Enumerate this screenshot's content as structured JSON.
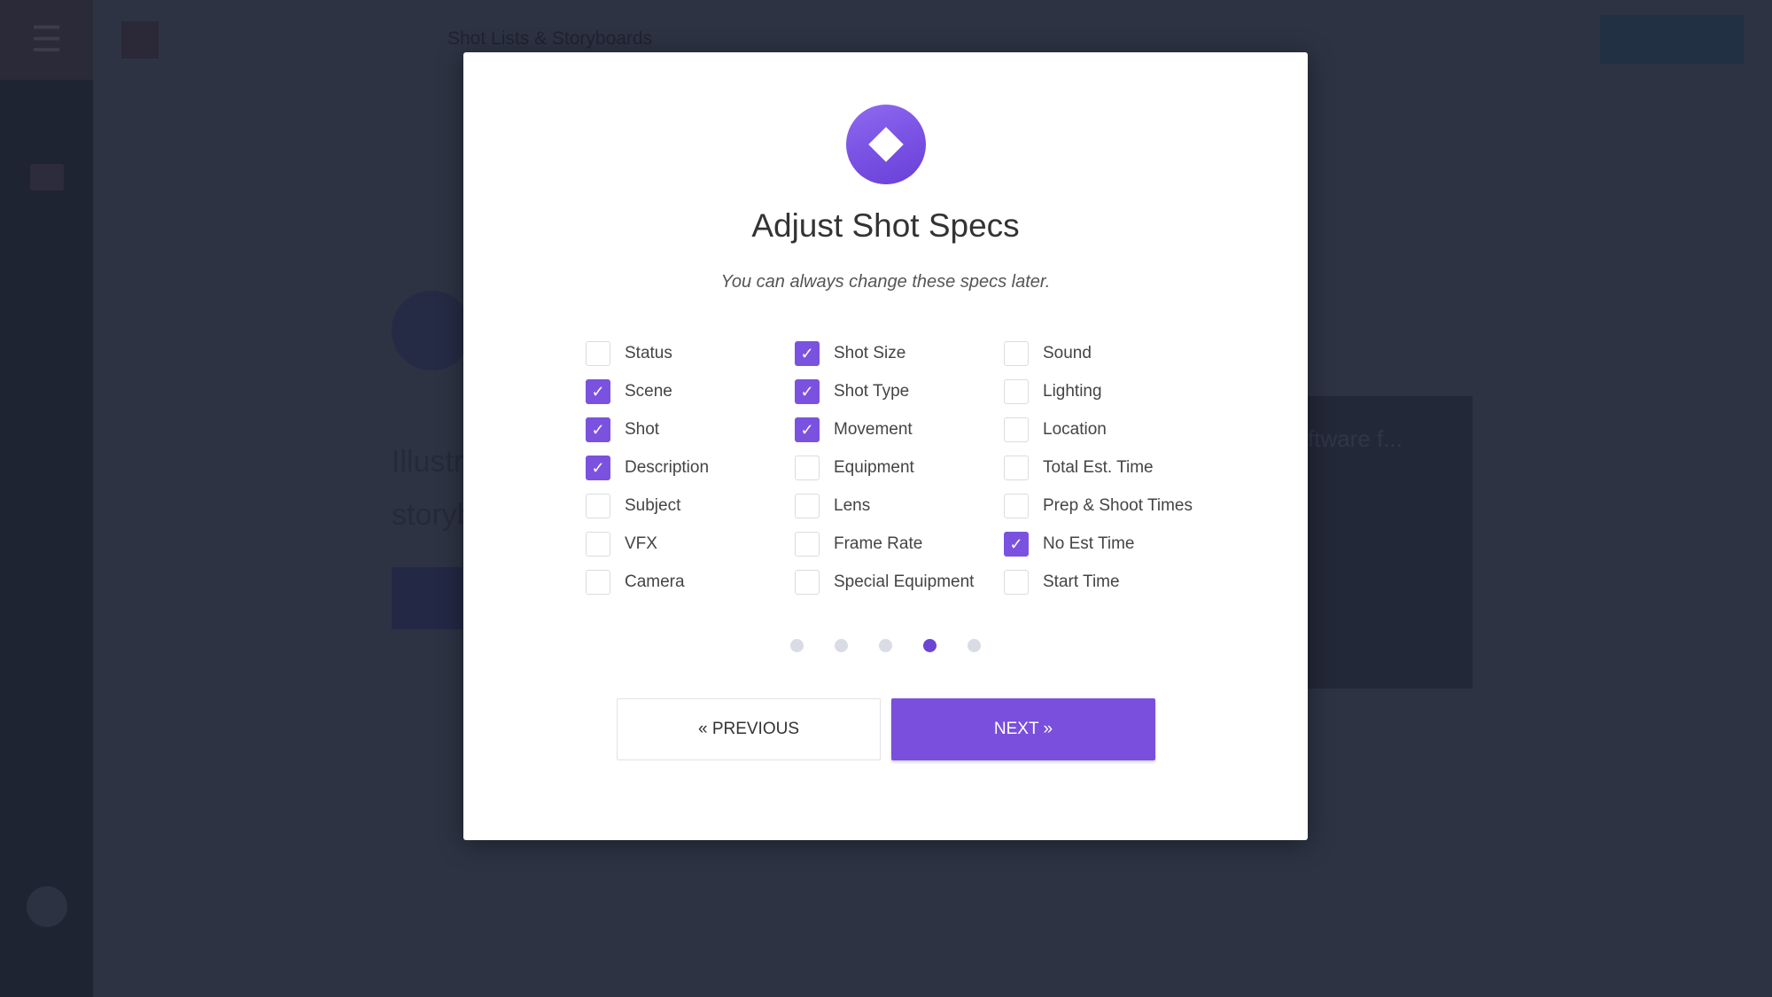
{
  "app": {
    "header_title": "Shot Lists & Storyboards"
  },
  "background": {
    "heading_line1": "Illustr",
    "heading_line2": "storyb",
    "card_title": "ftware f..."
  },
  "modal": {
    "title": "Adjust Shot Specs",
    "subtitle": "You can always change these specs later.",
    "columns": [
      [
        {
          "label": "Status",
          "checked": false
        },
        {
          "label": "Scene",
          "checked": true
        },
        {
          "label": "Shot",
          "checked": true
        },
        {
          "label": "Description",
          "checked": true
        },
        {
          "label": "Subject",
          "checked": false
        },
        {
          "label": "VFX",
          "checked": false
        },
        {
          "label": "Camera",
          "checked": false
        }
      ],
      [
        {
          "label": "Shot Size",
          "checked": true
        },
        {
          "label": "Shot Type",
          "checked": true
        },
        {
          "label": "Movement",
          "checked": true
        },
        {
          "label": "Equipment",
          "checked": false
        },
        {
          "label": "Lens",
          "checked": false
        },
        {
          "label": "Frame Rate",
          "checked": false
        },
        {
          "label": "Special Equipment",
          "checked": false
        }
      ],
      [
        {
          "label": "Sound",
          "checked": false
        },
        {
          "label": "Lighting",
          "checked": false
        },
        {
          "label": "Location",
          "checked": false
        },
        {
          "label": "Total Est. Time",
          "checked": false
        },
        {
          "label": "Prep & Shoot Times",
          "checked": false
        },
        {
          "label": "No Est Time",
          "checked": true
        },
        {
          "label": "Start Time",
          "checked": false
        }
      ]
    ],
    "pagination": {
      "total": 5,
      "current": 4
    },
    "previous_label": "« PREVIOUS",
    "next_label": "NEXT »",
    "accent_color": "#7b52e0",
    "icon": "diamond-icon"
  }
}
